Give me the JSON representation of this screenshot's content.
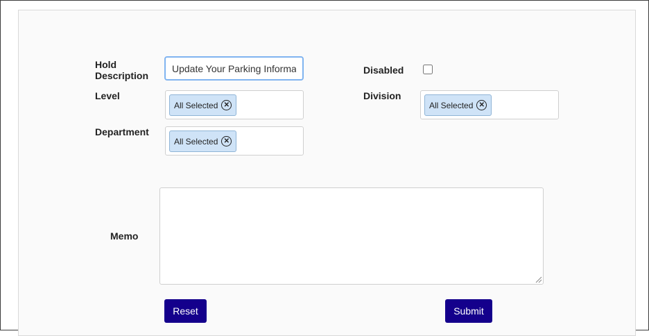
{
  "form": {
    "hold_description": {
      "label_line1": "Hold",
      "label_line2": "Description",
      "value": "Update Your Parking Informa"
    },
    "disabled": {
      "label": "Disabled",
      "checked": false
    },
    "level": {
      "label": "Level",
      "chip": "All Selected"
    },
    "division": {
      "label": "Division",
      "chip": "All Selected"
    },
    "department": {
      "label": "Department",
      "chip": "All Selected"
    },
    "memo": {
      "label": "Memo",
      "value": ""
    }
  },
  "actions": {
    "reset_label": "Reset",
    "submit_label": "Submit"
  },
  "colors": {
    "button_bg": "#14008c",
    "chip_bg": "#cfe3f7",
    "input_focus_border": "#80b4f0"
  },
  "icons": {
    "chip_remove": "circle-x-icon",
    "memo_resize": "resize-grip-icon"
  }
}
